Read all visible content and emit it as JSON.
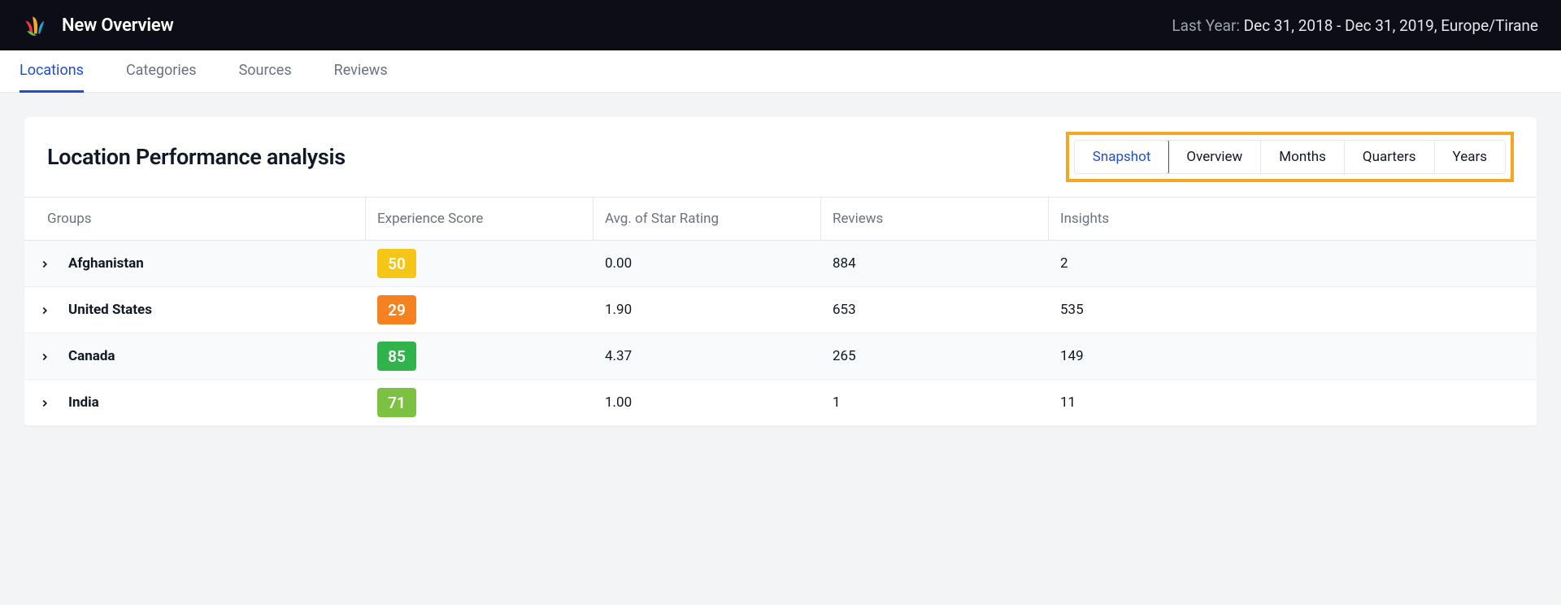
{
  "header": {
    "title": "New Overview",
    "date_range_label": "Last Year:",
    "date_range_value": "Dec 31, 2018 - Dec 31, 2019, Europe/Tirane"
  },
  "nav": {
    "tabs": [
      "Locations",
      "Categories",
      "Sources",
      "Reviews"
    ],
    "active_index": 0
  },
  "panel": {
    "title": "Location Performance analysis",
    "segments": [
      "Snapshot",
      "Overview",
      "Months",
      "Quarters",
      "Years"
    ],
    "active_segment_index": 0,
    "highlighted": true
  },
  "table": {
    "columns": [
      "Groups",
      "Experience Score",
      "Avg. of Star Rating",
      "Reviews",
      "Insights"
    ],
    "rows": [
      {
        "group": "Afghanistan",
        "score": "50",
        "score_color": "#f5c518",
        "avg": "0.00",
        "reviews": "884",
        "insights": "2"
      },
      {
        "group": "United States",
        "score": "29",
        "score_color": "#f58220",
        "avg": "1.90",
        "reviews": "653",
        "insights": "535"
      },
      {
        "group": "Canada",
        "score": "85",
        "score_color": "#2fb34a",
        "avg": "4.37",
        "reviews": "265",
        "insights": "149"
      },
      {
        "group": "India",
        "score": "71",
        "score_color": "#7cc142",
        "avg": "1.00",
        "reviews": "1",
        "insights": "11"
      }
    ]
  }
}
